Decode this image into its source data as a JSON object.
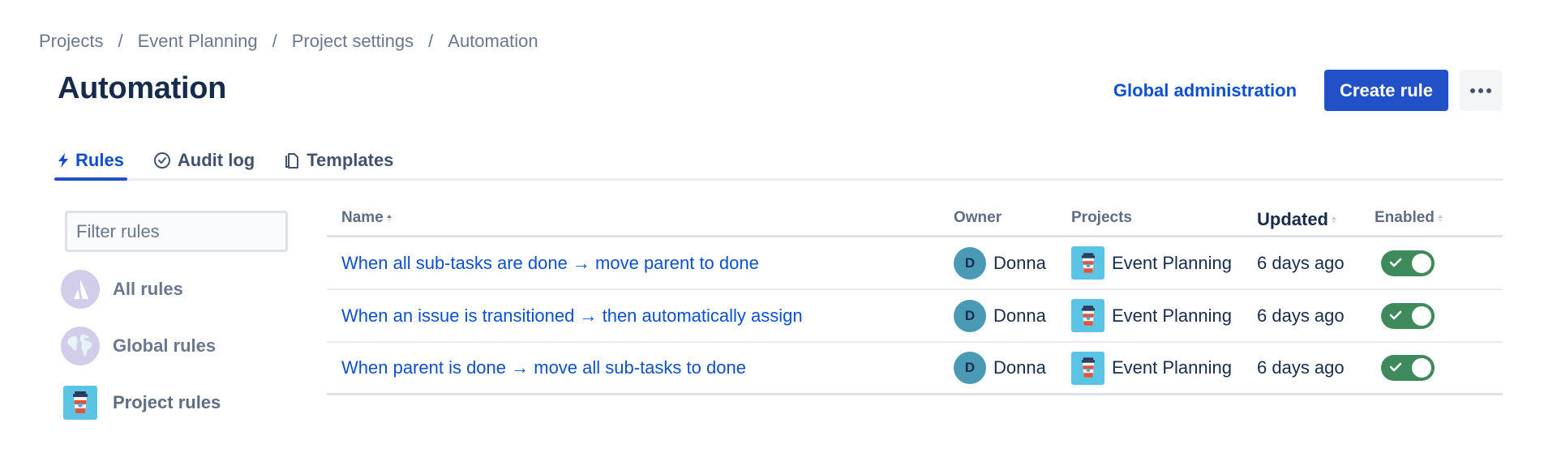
{
  "breadcrumb": [
    "Projects",
    "Event Planning",
    "Project settings",
    "Automation"
  ],
  "breadcrumb_separator": "/",
  "page": {
    "title": "Automation"
  },
  "header": {
    "global_admin_label": "Global administration",
    "create_rule_label": "Create rule",
    "more_icon": "more-horizontal-icon"
  },
  "tabs": [
    {
      "label": "Rules",
      "icon": "lightning-icon",
      "active": true
    },
    {
      "label": "Audit log",
      "icon": "check-circle-icon",
      "active": false
    },
    {
      "label": "Templates",
      "icon": "copy-icon",
      "active": false
    }
  ],
  "sidebar": {
    "filter_placeholder": "Filter rules",
    "filter_value": "",
    "items": [
      {
        "label": "All rules",
        "icon": "atlassian-logo-icon",
        "active": false
      },
      {
        "label": "Global rules",
        "icon": "globe-icon",
        "active": false
      },
      {
        "label": "Project rules",
        "icon": "coffee-cup-project-icon",
        "active": true
      }
    ]
  },
  "table": {
    "columns": [
      {
        "label": "Name",
        "sortable": true,
        "sort": "asc"
      },
      {
        "label": "Owner",
        "sortable": false
      },
      {
        "label": "Projects",
        "sortable": false
      },
      {
        "label": "Updated",
        "sortable": true
      },
      {
        "label": "Enabled",
        "sortable": true
      }
    ],
    "rows": [
      {
        "name": "When all sub-tasks are done → move parent to done",
        "owner_initial": "D",
        "owner": "Donna",
        "project": "Event Planning",
        "updated": "6 days ago",
        "enabled": true
      },
      {
        "name": "When an issue is transitioned → then automatically assign",
        "owner_initial": "D",
        "owner": "Donna",
        "project": "Event Planning",
        "updated": "6 days ago",
        "enabled": true
      },
      {
        "name": "When parent is done → move all sub-tasks to done",
        "owner_initial": "D",
        "owner": "Donna",
        "project": "Event Planning",
        "updated": "6 days ago",
        "enabled": true
      }
    ]
  },
  "colors": {
    "primary": "#2251c7",
    "link": "#0c4fcf",
    "toggle_on": "#3f8a5c",
    "avatar": "#4a9ab6",
    "project_icon_bg": "#5bc4e4",
    "sidebar_icon_bg": "#d2cde9"
  }
}
